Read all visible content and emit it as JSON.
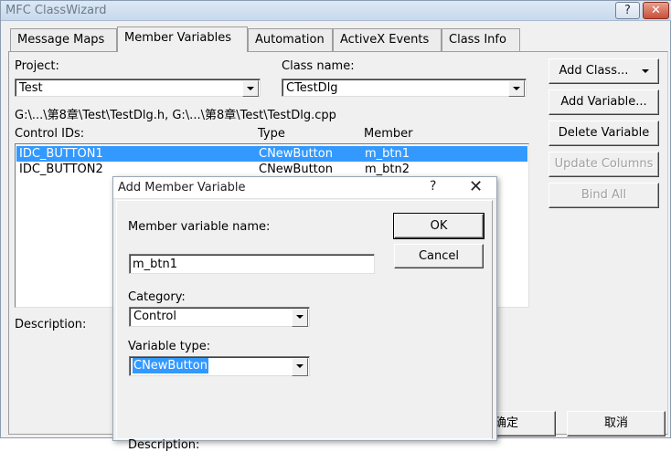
{
  "window": {
    "title": "MFC ClassWizard",
    "help_glyph": "?",
    "close_glyph": "✕"
  },
  "tabs": [
    {
      "label": "Message Maps"
    },
    {
      "label": "Member Variables"
    },
    {
      "label": "Automation"
    },
    {
      "label": "ActiveX Events"
    },
    {
      "label": "Class Info"
    }
  ],
  "project": {
    "label": "Project:",
    "value": "Test"
  },
  "classname": {
    "label": "Class name:",
    "value": "CTestDlg"
  },
  "files_path": "G:\\...\\第8章\\Test\\TestDlg.h, G:\\...\\第8章\\Test\\TestDlg.cpp",
  "list": {
    "headers": {
      "id": "Control IDs:",
      "type": "Type",
      "member": "Member"
    },
    "rows": [
      {
        "id": "IDC_BUTTON1",
        "type": "CNewButton",
        "member": "m_btn1"
      },
      {
        "id": "IDC_BUTTON2",
        "type": "CNewButton",
        "member": "m_btn2"
      }
    ]
  },
  "description_label": "Description:",
  "side_buttons": {
    "add_class": "Add Class...",
    "add_variable": "Add Variable...",
    "delete_variable": "Delete Variable",
    "update_columns": "Update Columns",
    "bind_all": "Bind All"
  },
  "bottom_buttons": {
    "ok": "确定",
    "cancel": "取消"
  },
  "dialog": {
    "title": "Add Member Variable",
    "help": "?",
    "close": "✕",
    "member_name_label": "Member variable name:",
    "member_name_value": "m_btn1",
    "category_label": "Category:",
    "category_value": "Control",
    "vartype_label": "Variable type:",
    "vartype_value": "CNewButton",
    "ok": "OK",
    "cancel": "Cancel",
    "description_label": "Description:"
  }
}
